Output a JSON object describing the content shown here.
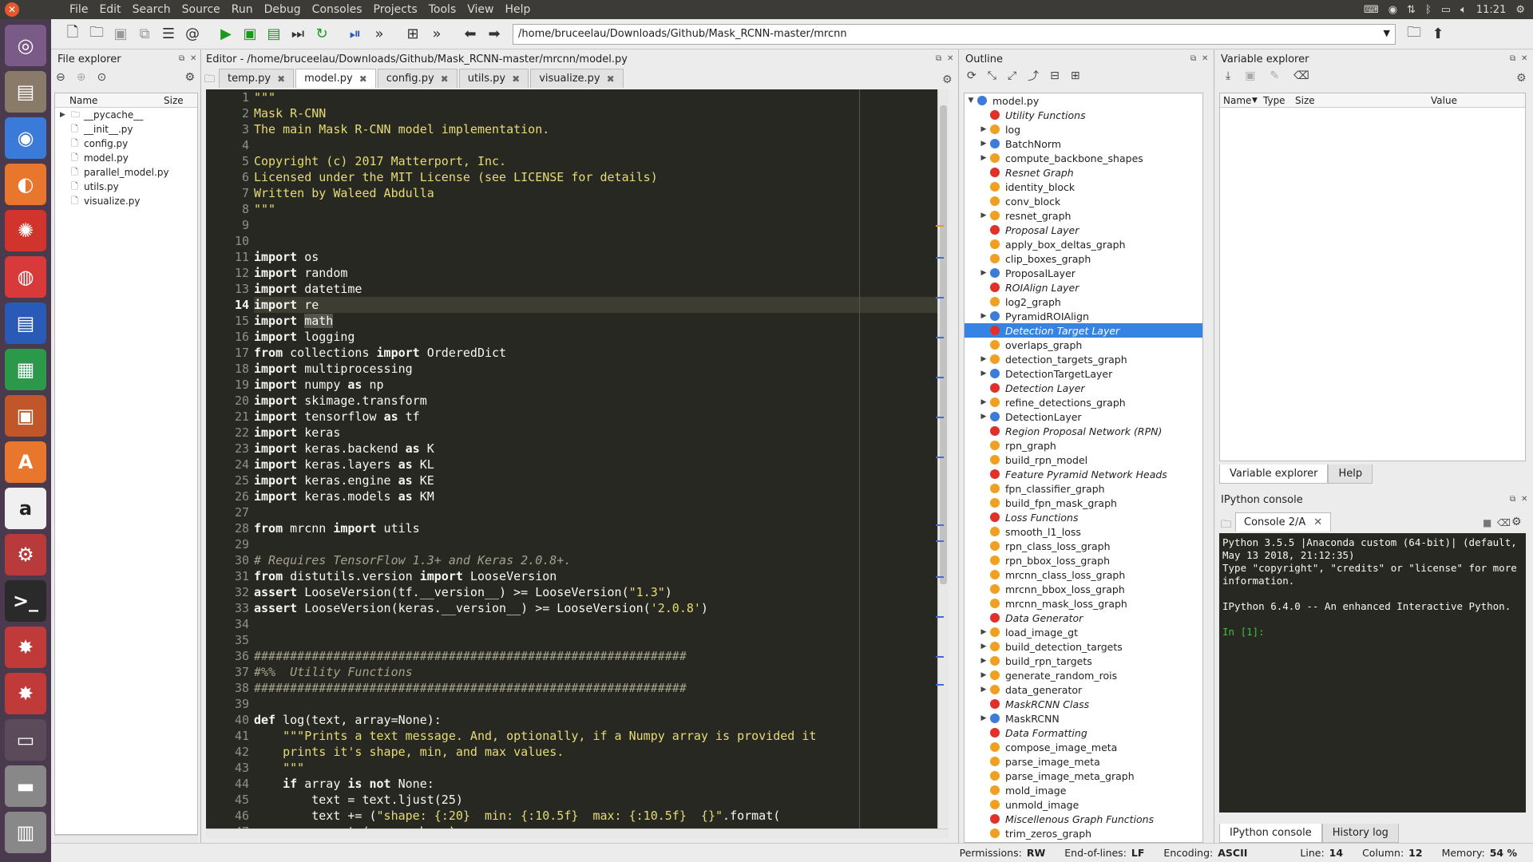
{
  "menubar": {
    "items": [
      "File",
      "Edit",
      "Search",
      "Source",
      "Run",
      "Debug",
      "Consoles",
      "Projects",
      "Tools",
      "View",
      "Help"
    ],
    "clock": "11:21"
  },
  "toolbar": {
    "path": "/home/bruceelau/Downloads/Github/Mask_RCNN-master/mrcnn"
  },
  "file_explorer": {
    "title": "File explorer",
    "col_name": "Name",
    "col_size": "Size",
    "items": [
      {
        "name": "__pycache__",
        "type": "folder"
      },
      {
        "name": "__init__.py",
        "type": "file"
      },
      {
        "name": "config.py",
        "type": "file"
      },
      {
        "name": "model.py",
        "type": "file"
      },
      {
        "name": "parallel_model.py",
        "type": "file"
      },
      {
        "name": "utils.py",
        "type": "file"
      },
      {
        "name": "visualize.py",
        "type": "file"
      }
    ]
  },
  "editor": {
    "title": "Editor - /home/bruceelau/Downloads/Github/Mask_RCNN-master/mrcnn/model.py",
    "tabs": [
      {
        "label": "temp.py",
        "active": false
      },
      {
        "label": "model.py",
        "active": true
      },
      {
        "label": "config.py",
        "active": false
      },
      {
        "label": "utils.py",
        "active": false
      },
      {
        "label": "visualize.py",
        "active": false
      }
    ],
    "current_line": 14,
    "lines": [
      [
        [
          "s",
          "\"\"\""
        ]
      ],
      [
        [
          "s",
          "Mask R-CNN"
        ]
      ],
      [
        [
          "s",
          "The main Mask R-CNN model implementation."
        ]
      ],
      [
        [
          "s",
          ""
        ]
      ],
      [
        [
          "s",
          "Copyright (c) 2017 Matterport, Inc."
        ]
      ],
      [
        [
          "s",
          "Licensed under the MIT License (see LICENSE for details)"
        ]
      ],
      [
        [
          "s",
          "Written by Waleed Abdulla"
        ]
      ],
      [
        [
          "s",
          "\"\"\""
        ]
      ],
      [],
      [],
      [
        [
          "k",
          "import"
        ],
        [
          "t",
          " os"
        ]
      ],
      [
        [
          "k",
          "import"
        ],
        [
          "t",
          " random"
        ]
      ],
      [
        [
          "k",
          "import"
        ],
        [
          "t",
          " datetime"
        ]
      ],
      [
        [
          "k",
          "import"
        ],
        [
          "t",
          " re"
        ]
      ],
      [
        [
          "k",
          "import"
        ],
        [
          "t",
          " "
        ],
        [
          "h",
          "math"
        ]
      ],
      [
        [
          "k",
          "import"
        ],
        [
          "t",
          " logging"
        ]
      ],
      [
        [
          "k",
          "from"
        ],
        [
          "t",
          " collections "
        ],
        [
          "k",
          "import"
        ],
        [
          "t",
          " OrderedDict"
        ]
      ],
      [
        [
          "k",
          "import"
        ],
        [
          "t",
          " multiprocessing"
        ]
      ],
      [
        [
          "k",
          "import"
        ],
        [
          "t",
          " numpy "
        ],
        [
          "k",
          "as"
        ],
        [
          "t",
          " np"
        ]
      ],
      [
        [
          "k",
          "import"
        ],
        [
          "t",
          " skimage.transform"
        ]
      ],
      [
        [
          "k",
          "import"
        ],
        [
          "t",
          " tensorflow "
        ],
        [
          "k",
          "as"
        ],
        [
          "t",
          " tf"
        ]
      ],
      [
        [
          "k",
          "import"
        ],
        [
          "t",
          " keras"
        ]
      ],
      [
        [
          "k",
          "import"
        ],
        [
          "t",
          " keras.backend "
        ],
        [
          "k",
          "as"
        ],
        [
          "t",
          " K"
        ]
      ],
      [
        [
          "k",
          "import"
        ],
        [
          "t",
          " keras.layers "
        ],
        [
          "k",
          "as"
        ],
        [
          "t",
          " KL"
        ]
      ],
      [
        [
          "k",
          "import"
        ],
        [
          "t",
          " keras.engine "
        ],
        [
          "k",
          "as"
        ],
        [
          "t",
          " KE"
        ]
      ],
      [
        [
          "k",
          "import"
        ],
        [
          "t",
          " keras.models "
        ],
        [
          "k",
          "as"
        ],
        [
          "t",
          " KM"
        ]
      ],
      [],
      [
        [
          "k",
          "from"
        ],
        [
          "t",
          " mrcnn "
        ],
        [
          "k",
          "import"
        ],
        [
          "t",
          " utils"
        ]
      ],
      [],
      [
        [
          "c",
          "# Requires TensorFlow 1.3+ and Keras 2.0.8+."
        ]
      ],
      [
        [
          "k",
          "from"
        ],
        [
          "t",
          " distutils.version "
        ],
        [
          "k",
          "import"
        ],
        [
          "t",
          " LooseVersion"
        ]
      ],
      [
        [
          "k",
          "assert"
        ],
        [
          "t",
          " LooseVersion(tf.__version__) >= LooseVersion("
        ],
        [
          "s",
          "\"1.3\""
        ],
        [
          "t",
          ")"
        ]
      ],
      [
        [
          "k",
          "assert"
        ],
        [
          "t",
          " LooseVersion(keras.__version__) >= LooseVersion("
        ],
        [
          "s",
          "'2.0.8'"
        ],
        [
          "t",
          ")"
        ]
      ],
      [],
      [],
      [
        [
          "c",
          "############################################################"
        ]
      ],
      [
        [
          "c",
          "#%%  Utility Functions"
        ]
      ],
      [
        [
          "c",
          "############################################################"
        ]
      ],
      [],
      [
        [
          "k",
          "def"
        ],
        [
          "t",
          " log(text, array=None):"
        ]
      ],
      [
        [
          "t",
          "    "
        ],
        [
          "s",
          "\"\"\"Prints a text message. And, optionally, if a Numpy array is provided it"
        ]
      ],
      [
        [
          "s",
          "    prints it's shape, min, and max values."
        ]
      ],
      [
        [
          "s",
          "    \"\"\""
        ]
      ],
      [
        [
          "t",
          "    "
        ],
        [
          "k",
          "if"
        ],
        [
          "t",
          " array "
        ],
        [
          "k",
          "is not"
        ],
        [
          "t",
          " None:"
        ]
      ],
      [
        [
          "t",
          "        text = text.ljust(25)"
        ]
      ],
      [
        [
          "t",
          "        text += ("
        ],
        [
          "s",
          "\"shape: {:20}  min: {:10.5f}  max: {:10.5f}  {}\""
        ],
        [
          "t",
          ".format("
        ]
      ],
      [
        [
          "t",
          "            str(array.shape),"
        ]
      ]
    ]
  },
  "outline": {
    "title": "Outline",
    "root": "model.py",
    "items": [
      {
        "label": "Utility Functions",
        "kind": "cell",
        "arrow": false
      },
      {
        "label": "log",
        "kind": "f",
        "arrow": true
      },
      {
        "label": "BatchNorm",
        "kind": "c",
        "arrow": true
      },
      {
        "label": "compute_backbone_shapes",
        "kind": "f",
        "arrow": true
      },
      {
        "label": "Resnet Graph",
        "kind": "cell",
        "arrow": false
      },
      {
        "label": "identity_block",
        "kind": "f",
        "arrow": false
      },
      {
        "label": "conv_block",
        "kind": "f",
        "arrow": false
      },
      {
        "label": "resnet_graph",
        "kind": "f",
        "arrow": true
      },
      {
        "label": "Proposal Layer",
        "kind": "cell",
        "arrow": false
      },
      {
        "label": "apply_box_deltas_graph",
        "kind": "f",
        "arrow": false
      },
      {
        "label": "clip_boxes_graph",
        "kind": "f",
        "arrow": false
      },
      {
        "label": "ProposalLayer",
        "kind": "c",
        "arrow": true
      },
      {
        "label": "ROIAlign Layer",
        "kind": "cell",
        "arrow": false
      },
      {
        "label": "log2_graph",
        "kind": "f",
        "arrow": false
      },
      {
        "label": "PyramidROIAlign",
        "kind": "c",
        "arrow": true
      },
      {
        "label": "Detection Target Layer",
        "kind": "cell",
        "arrow": false,
        "selected": true
      },
      {
        "label": "overlaps_graph",
        "kind": "f",
        "arrow": false
      },
      {
        "label": "detection_targets_graph",
        "kind": "f",
        "arrow": true
      },
      {
        "label": "DetectionTargetLayer",
        "kind": "c",
        "arrow": true
      },
      {
        "label": "Detection Layer",
        "kind": "cell",
        "arrow": false
      },
      {
        "label": "refine_detections_graph",
        "kind": "f",
        "arrow": true
      },
      {
        "label": "DetectionLayer",
        "kind": "c",
        "arrow": true
      },
      {
        "label": "Region Proposal Network (RPN)",
        "kind": "cell",
        "arrow": false
      },
      {
        "label": "rpn_graph",
        "kind": "f",
        "arrow": false
      },
      {
        "label": "build_rpn_model",
        "kind": "f",
        "arrow": false
      },
      {
        "label": "Feature Pyramid Network Heads",
        "kind": "cell",
        "arrow": false
      },
      {
        "label": "fpn_classifier_graph",
        "kind": "f",
        "arrow": false
      },
      {
        "label": "build_fpn_mask_graph",
        "kind": "f",
        "arrow": false
      },
      {
        "label": "Loss Functions",
        "kind": "cell",
        "arrow": false
      },
      {
        "label": "smooth_l1_loss",
        "kind": "f",
        "arrow": false
      },
      {
        "label": "rpn_class_loss_graph",
        "kind": "f",
        "arrow": false
      },
      {
        "label": "rpn_bbox_loss_graph",
        "kind": "f",
        "arrow": false
      },
      {
        "label": "mrcnn_class_loss_graph",
        "kind": "f",
        "arrow": false
      },
      {
        "label": "mrcnn_bbox_loss_graph",
        "kind": "f",
        "arrow": false
      },
      {
        "label": "mrcnn_mask_loss_graph",
        "kind": "f",
        "arrow": false
      },
      {
        "label": "Data Generator",
        "kind": "cell",
        "arrow": false
      },
      {
        "label": "load_image_gt",
        "kind": "f",
        "arrow": true
      },
      {
        "label": "build_detection_targets",
        "kind": "f",
        "arrow": true
      },
      {
        "label": "build_rpn_targets",
        "kind": "f",
        "arrow": true
      },
      {
        "label": "generate_random_rois",
        "kind": "f",
        "arrow": true
      },
      {
        "label": "data_generator",
        "kind": "f",
        "arrow": true
      },
      {
        "label": "MaskRCNN Class",
        "kind": "cell",
        "arrow": false
      },
      {
        "label": "MaskRCNN",
        "kind": "c",
        "arrow": true
      },
      {
        "label": "Data Formatting",
        "kind": "cell",
        "arrow": false
      },
      {
        "label": "compose_image_meta",
        "kind": "f",
        "arrow": false
      },
      {
        "label": "parse_image_meta",
        "kind": "f",
        "arrow": false
      },
      {
        "label": "parse_image_meta_graph",
        "kind": "f",
        "arrow": false
      },
      {
        "label": "mold_image",
        "kind": "f",
        "arrow": false
      },
      {
        "label": "unmold_image",
        "kind": "f",
        "arrow": false
      },
      {
        "label": "Miscellenous Graph Functions",
        "kind": "cell",
        "arrow": false
      },
      {
        "label": "trim_zeros_graph",
        "kind": "f",
        "arrow": false
      }
    ]
  },
  "variable_explorer": {
    "title": "Variable explorer",
    "col_name": "Name",
    "col_type": "Type",
    "col_size": "Size",
    "col_value": "Value",
    "tab_var": "Variable explorer",
    "tab_help": "Help"
  },
  "ipython": {
    "title": "IPython console",
    "tab": "Console 2/A",
    "text": "Python 3.5.5 |Anaconda custom (64-bit)| (default,\nMay 13 2018, 21:12:35)\nType \"copyright\", \"credits\" or \"license\" for more\ninformation.\n\nIPython 6.4.0 -- An enhanced Interactive Python.\n\n",
    "prompt": "In [1]:",
    "tab_console": "IPython console",
    "tab_history": "History log"
  },
  "status": {
    "permissions_label": "Permissions:",
    "permissions": "RW",
    "eol_label": "End-of-lines:",
    "eol": "LF",
    "encoding_label": "Encoding:",
    "encoding": "ASCII",
    "line_label": "Line:",
    "line": "14",
    "column_label": "Column:",
    "column": "12",
    "memory_label": "Memory:",
    "memory": "54 %"
  }
}
